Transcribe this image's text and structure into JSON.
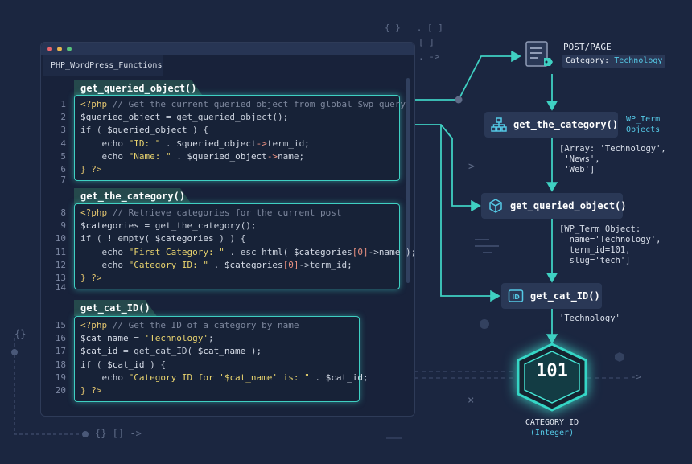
{
  "window": {
    "tab_title": "PHP_WordPress_Functions",
    "dot_colors": [
      "#e8646a",
      "#e8b44e",
      "#57c27b"
    ]
  },
  "blocks": [
    {
      "label": "get_queried_object()",
      "lines": [
        {
          "n": "1",
          "tokens": [
            {
              "t": "<?php ",
              "c": "k"
            },
            {
              "t": "// Get the current queried object from global $wp_query",
              "c": "c"
            }
          ]
        },
        {
          "n": "2",
          "tokens": [
            {
              "t": "$queried_object",
              "c": "v"
            },
            {
              "t": " = get_queried_object();",
              "c": "p"
            }
          ]
        },
        {
          "n": "3",
          "tokens": [
            {
              "t": "if",
              "c": "p"
            },
            {
              "t": " ( ",
              "c": "p"
            },
            {
              "t": "$queried_object",
              "c": "v"
            },
            {
              "t": " ) {",
              "c": "p"
            }
          ]
        },
        {
          "n": "4",
          "tokens": [
            {
              "t": "    echo ",
              "c": "p"
            },
            {
              "t": "\"ID: \"",
              "c": "s"
            },
            {
              "t": " . ",
              "c": "p"
            },
            {
              "t": "$queried_object",
              "c": "v"
            },
            {
              "t": "->",
              "c": "a"
            },
            {
              "t": "term_id;",
              "c": "p"
            }
          ]
        },
        {
          "n": "5",
          "tokens": [
            {
              "t": "    echo ",
              "c": "p"
            },
            {
              "t": "\"Name: \"",
              "c": "s"
            },
            {
              "t": " . ",
              "c": "p"
            },
            {
              "t": "$queried_object",
              "c": "v"
            },
            {
              "t": "->",
              "c": "a"
            },
            {
              "t": "name;",
              "c": "p"
            }
          ]
        },
        {
          "n": "6",
          "tokens": [
            {
              "t": "} ?>",
              "c": "k"
            }
          ]
        }
      ],
      "trailing": "7"
    },
    {
      "label": "get_the_category()",
      "lines": [
        {
          "n": "8",
          "tokens": [
            {
              "t": "<?php ",
              "c": "k"
            },
            {
              "t": "// Retrieve categories for the current post",
              "c": "c"
            }
          ]
        },
        {
          "n": "9",
          "tokens": [
            {
              "t": "$categories",
              "c": "v"
            },
            {
              "t": " = get_the_category();",
              "c": "p"
            }
          ]
        },
        {
          "n": "10",
          "tokens": [
            {
              "t": "if",
              "c": "p"
            },
            {
              "t": " ( ! empty( ",
              "c": "p"
            },
            {
              "t": "$categories",
              "c": "v"
            },
            {
              "t": " ) ) {",
              "c": "p"
            }
          ]
        },
        {
          "n": "11",
          "tokens": [
            {
              "t": "    echo ",
              "c": "p"
            },
            {
              "t": "\"First Category: \"",
              "c": "s"
            },
            {
              "t": " . esc_html( ",
              "c": "p"
            },
            {
              "t": "$categories",
              "c": "v"
            },
            {
              "t": "[0]",
              "c": "a"
            },
            {
              "t": "->name );",
              "c": "p"
            }
          ]
        },
        {
          "n": "12",
          "tokens": [
            {
              "t": "    echo ",
              "c": "p"
            },
            {
              "t": "\"Category ID: \"",
              "c": "s"
            },
            {
              "t": " . ",
              "c": "p"
            },
            {
              "t": "$categories",
              "c": "v"
            },
            {
              "t": "[0]",
              "c": "a"
            },
            {
              "t": "->term_id;",
              "c": "p"
            }
          ]
        },
        {
          "n": "13",
          "tokens": [
            {
              "t": "} ?>",
              "c": "k"
            }
          ]
        }
      ],
      "trailing": "14"
    },
    {
      "label": "get_cat_ID()",
      "lines": [
        {
          "n": "15",
          "tokens": [
            {
              "t": "<?php ",
              "c": "k"
            },
            {
              "t": "// Get the ID of a category by name",
              "c": "c"
            }
          ]
        },
        {
          "n": "16",
          "tokens": [
            {
              "t": "$cat_name",
              "c": "v"
            },
            {
              "t": " = ",
              "c": "p"
            },
            {
              "t": "'Technology'",
              "c": "s"
            },
            {
              "t": ";",
              "c": "p"
            }
          ]
        },
        {
          "n": "17",
          "tokens": [
            {
              "t": "$cat_id",
              "c": "v"
            },
            {
              "t": " = get_cat_ID( ",
              "c": "p"
            },
            {
              "t": "$cat_name",
              "c": "v"
            },
            {
              "t": " );",
              "c": "p"
            }
          ]
        },
        {
          "n": "18",
          "tokens": [
            {
              "t": "if",
              "c": "p"
            },
            {
              "t": " ( ",
              "c": "p"
            },
            {
              "t": "$cat_id",
              "c": "v"
            },
            {
              "t": " ) {",
              "c": "p"
            }
          ]
        },
        {
          "n": "19",
          "tokens": [
            {
              "t": "    echo ",
              "c": "p"
            },
            {
              "t": "\"Category ID for '$cat_name' is: \"",
              "c": "s"
            },
            {
              "t": " . ",
              "c": "p"
            },
            {
              "t": "$cat_id",
              "c": "v"
            },
            {
              "t": ";",
              "c": "p"
            }
          ]
        },
        {
          "n": "20",
          "tokens": [
            {
              "t": "} ?>",
              "c": "k"
            }
          ]
        }
      ],
      "trailing": ""
    }
  ],
  "flow": {
    "post_title": "POST/PAGE",
    "post_category_key": "Category: ",
    "post_category_value": "Technology",
    "node1": "get_the_category()",
    "node1_side": "WP_Term\nObjects",
    "ann1": "[Array: 'Technology',\n 'News',\n 'Web']",
    "node2": "get_queried_object()",
    "ann2": "[WP_Term Object:\n  name='Technology',\n  term_id=101,\n  slug='tech']",
    "node3": "get_cat_ID()",
    "ann3": "'Technology'",
    "hex_value": "101",
    "result_label": "CATEGORY ID",
    "result_sub": "(Integer)"
  },
  "decor": {
    "braces_top": "{ }   . [ ]",
    "brackets_top": "[ ]",
    "arrow_top": ". ->",
    "braces_left": "{}",
    "bottom_text": "{} [] ->",
    "chevron": ">",
    "right_arrow": "->",
    "cross": "×"
  },
  "colors": {
    "accent": "#3fd0c2",
    "background": "#1b2640",
    "node": "#2a3856"
  }
}
